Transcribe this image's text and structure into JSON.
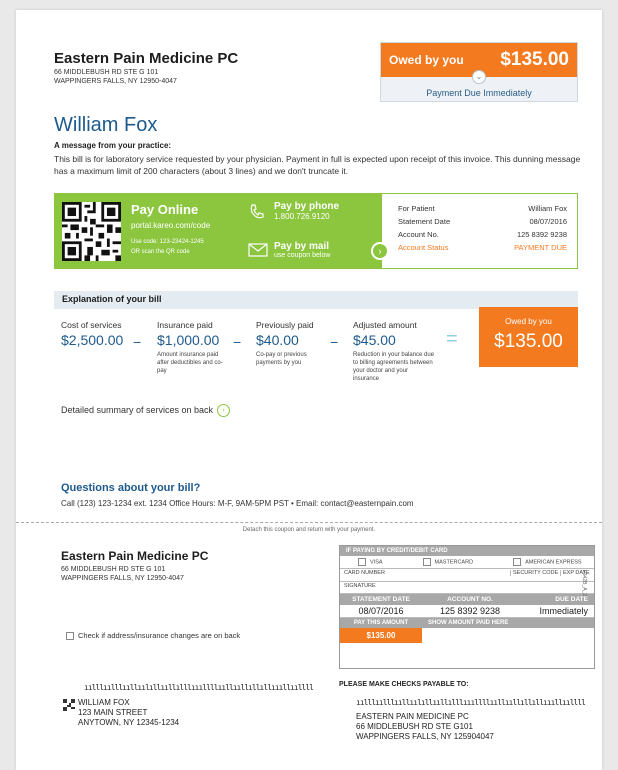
{
  "practice": {
    "name": "Eastern Pain Medicine PC",
    "address_line1": "66 MIDDLEBUSH RD STE G 101",
    "address_line2": "WAPPINGERS FALLS, NY 12950-4047"
  },
  "owed": {
    "label": "Owed by you",
    "amount": "$135.00",
    "due": "Payment Due Immediately"
  },
  "patient": {
    "name": "William Fox"
  },
  "message": {
    "heading": "A message from your practice:",
    "body": "This bill is for laboratory service requested by your physician. Payment in full is expected upon receipt of this invoice. This dunning message has a maximum limit of 200 characters (about 3 lines) and we don't truncate it."
  },
  "pay": {
    "online_title": "Pay Online",
    "online_url": "portal.kareo.com/code",
    "use_code": "Use code: 123-23424-1245",
    "scan_qr": "OR scan the QR code",
    "phone_title": "Pay by phone",
    "phone_number": "1.800.726.9120",
    "mail_title": "Pay by mail",
    "mail_sub": "use coupon below",
    "colors": {
      "green": "#8cc63f",
      "orange": "#f47a20",
      "blue": "#1e5a8c"
    }
  },
  "account": {
    "rows": [
      {
        "label": "For Patient",
        "value": "William Fox"
      },
      {
        "label": "Statement Date",
        "value": "08/07/2016"
      },
      {
        "label": "Account No.",
        "value": "125 8392 9238"
      },
      {
        "label": "Account Status",
        "value": "PAYMENT DUE"
      }
    ]
  },
  "explanation": {
    "title": "Explanation of your bill",
    "items": [
      {
        "label": "Cost of services",
        "value": "$2,500.00",
        "note": ""
      },
      {
        "label": "Insurance paid",
        "value": "$1,000.00",
        "note": "Amount insurance paid after deductibles and co-pay"
      },
      {
        "label": "Previously paid",
        "value": "$40.00",
        "note": "Co-pay or previous payments by you"
      },
      {
        "label": "Adjusted amount",
        "value": "$45.00",
        "note": "Reduction in your balance due to billing agreements between your doctor and your insurance"
      }
    ],
    "minus": "−",
    "equals": "=",
    "owed_label": "Owed by you",
    "owed_amount": "$135.00"
  },
  "summary_link": "Detailed summary of services on back",
  "questions": {
    "title": "Questions about your bill?",
    "contact": "Call (123) 123-1234 ext. 1234   Office Hours: M-F, 9AM-5PM PST  •  Email: contact@easternpain.com"
  },
  "coupon": {
    "detach": "Detach this coupon and return with your payment.",
    "practice_name": "Eastern Pain Medicine PC",
    "practice_addr1": "66 MIDDLEBUSH RD STE G 101",
    "practice_addr2": "WAPPINGERS FALLS, NY 12950-4047",
    "check_label": "Check if address/insurance changes are on back",
    "barcode_glyphs": "ıılllıılllııllıılıllııllılllıııllllııllııllıllıllıııllııllll",
    "patient_addr": [
      "WILLIAM FOX",
      "123 MAIN STREET",
      "ANYTOWN, NY 12345-1234"
    ],
    "card": {
      "header": "IF PAYING BY CREDIT/DEBIT CARD",
      "types": [
        "VISA",
        "MASTERCARD",
        "AMERICAN EXPRESS"
      ],
      "card_number": "CARD NUMBER",
      "security_code": "SECURITY CODE",
      "exp_date": "EXP DATE",
      "signature": "SIGNATURE"
    },
    "statement_headers": [
      "STATEMENT DATE",
      "ACCOUNT NO.",
      "DUE DATE"
    ],
    "statement_values": [
      "08/07/2016",
      "125 8392 9238",
      "Immediately"
    ],
    "pay_headers": [
      "PAY THIS AMOUNT",
      "SHOW AMOUNT PAID HERE"
    ],
    "pay_amount": "$135.00",
    "side_code": "9342B_A_2",
    "checks_payable": "PLEASE MAKE CHECKS PAYABLE TO:",
    "remit_addr": [
      "EASTERN PAIN MEDICINE PC",
      "66 MIDDLEBUSH RD STE G101",
      "WAPPINGERS FALLS, NY 125904047"
    ]
  }
}
